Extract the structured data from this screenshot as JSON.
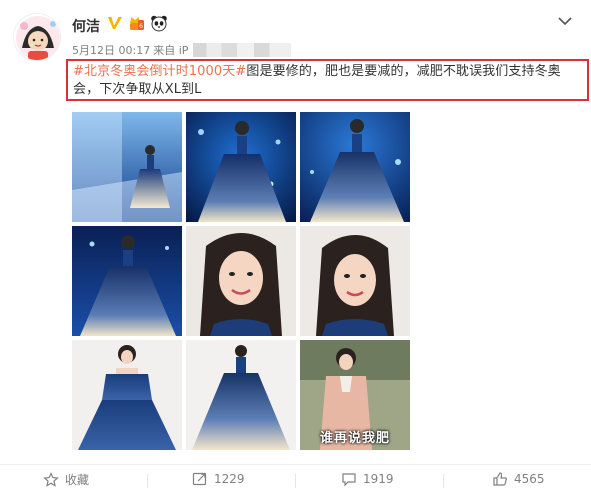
{
  "user": {
    "name": "何洁",
    "time": "5月12日 00:17",
    "source_prefix": "来自 iP"
  },
  "post": {
    "topic": "#北京冬奥会倒计时1000天#",
    "text": "图是要修的，肥也是要减的，减肥不耽误我们支持冬奥会，下次争取从XL到L"
  },
  "images": [
    {
      "caption": ""
    },
    {
      "caption": ""
    },
    {
      "caption": ""
    },
    {
      "caption": ""
    },
    {
      "caption": ""
    },
    {
      "caption": ""
    },
    {
      "caption": ""
    },
    {
      "caption": ""
    },
    {
      "caption": "谁再说我肥"
    }
  ],
  "actions": {
    "favorite_label": "收藏",
    "repost_count": "1229",
    "comment_count": "1919",
    "like_count": "4565"
  },
  "colors": {
    "topic": "#eb7350",
    "highlight_border": "#d9303a",
    "muted_text": "#808080"
  },
  "icons": [
    "chevron-down-icon",
    "verified-icon",
    "crown-icon",
    "panda-icon",
    "star-icon",
    "repost-icon",
    "comment-icon",
    "like-icon"
  ]
}
